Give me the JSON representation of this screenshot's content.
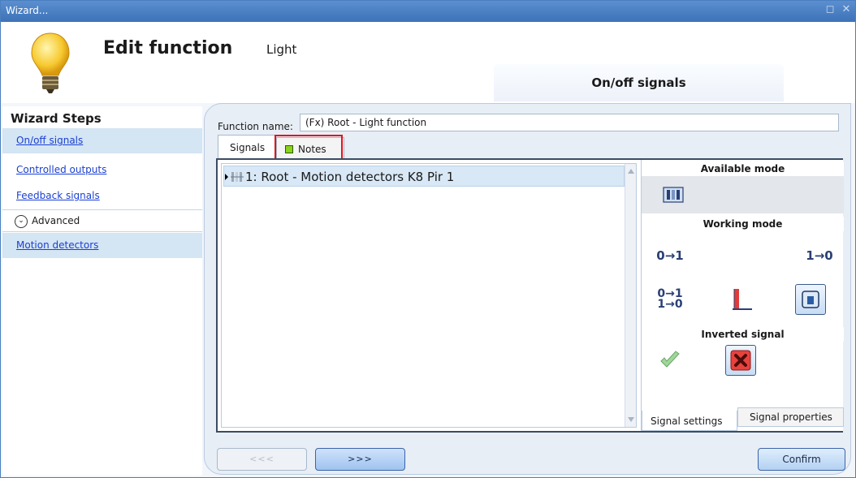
{
  "window": {
    "title": "Wizard...",
    "restore_glyph": "◻",
    "close_glyph": "✕"
  },
  "header": {
    "title": "Edit function",
    "subtitle": "Light",
    "section_tab": "On/off signals",
    "icon": "light-bulb-icon"
  },
  "sidebar": {
    "title": "Wizard Steps",
    "items": [
      {
        "label": "On/off signals",
        "active": true
      },
      {
        "label": "Controlled outputs",
        "active": false
      },
      {
        "label": "Feedback signals",
        "active": false
      }
    ],
    "advanced": {
      "label": "Advanced",
      "icon": "chevron-down-circle-icon"
    },
    "advanced_items": [
      {
        "label": "Motion detectors"
      }
    ]
  },
  "form": {
    "function_name_label": "Function name:",
    "function_name_value": "(Fx) Root - Light function"
  },
  "tabs": {
    "signals": "Signals",
    "notes": "Notes"
  },
  "signal_list": {
    "rows": [
      {
        "label": "1: Root - Motion detectors K8 Pir 1",
        "icon": "motion-detector-icon"
      }
    ]
  },
  "right_panel": {
    "available_mode": "Available mode",
    "working_mode": "Working mode",
    "inverted_signal": "Inverted signal",
    "mode_0to1": "0→1",
    "mode_1to0": "1→0",
    "mode_both_top": "0→1",
    "mode_both_bottom": "1→0",
    "bottom_tabs": {
      "settings": "Signal settings",
      "properties": "Signal properties"
    }
  },
  "nav": {
    "prev": "<<<",
    "next": ">>>",
    "confirm": "Confirm"
  },
  "colors": {
    "accent": "#3d72b8",
    "link": "#1a3fd1",
    "highlight": "#e0141e",
    "notes_square": "#8bd21c"
  }
}
